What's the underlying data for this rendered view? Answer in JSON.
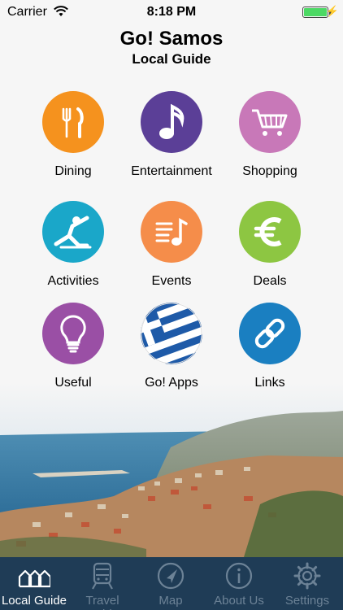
{
  "status": {
    "carrier": "Carrier",
    "time": "8:18 PM"
  },
  "header": {
    "title": "Go! Samos",
    "subtitle": "Local Guide"
  },
  "tiles": [
    {
      "label": "Dining",
      "icon": "fork-knife-icon",
      "color": "#f5921e"
    },
    {
      "label": "Entertainment",
      "icon": "music-note-icon",
      "color": "#5b3f97"
    },
    {
      "label": "Shopping",
      "icon": "shopping-cart-icon",
      "color": "#c878b8"
    },
    {
      "label": "Activities",
      "icon": "stretching-person-icon",
      "color": "#1aa7c9"
    },
    {
      "label": "Events",
      "icon": "event-list-icon",
      "color": "#f58d4a"
    },
    {
      "label": "Deals",
      "icon": "euro-icon",
      "color": "#8dc642"
    },
    {
      "label": "Useful",
      "icon": "lightbulb-icon",
      "color": "#9a4fa5"
    },
    {
      "label": "Go! Apps",
      "icon": "greek-flag-icon",
      "color": "#1e5aa8"
    },
    {
      "label": "Links",
      "icon": "link-icon",
      "color": "#1a7fc1"
    }
  ],
  "tabs": [
    {
      "label": "Local Guide",
      "icon": "houses-icon",
      "active": true
    },
    {
      "label": "Travel Guide",
      "icon": "train-icon",
      "active": false
    },
    {
      "label": "Map",
      "icon": "compass-arrow-icon",
      "active": false
    },
    {
      "label": "About Us",
      "icon": "info-icon",
      "active": false
    },
    {
      "label": "Settings",
      "icon": "gear-icon",
      "active": false
    }
  ]
}
